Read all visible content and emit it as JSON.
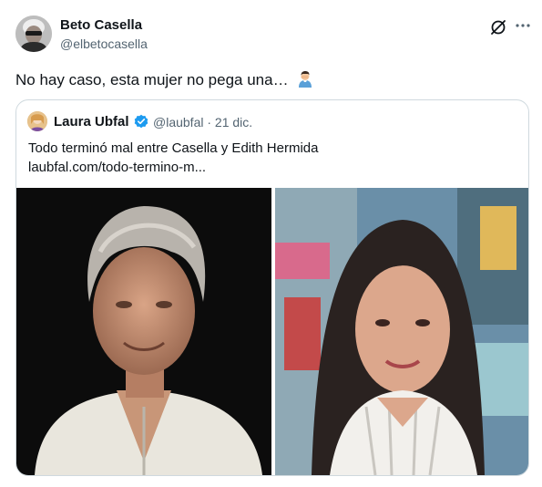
{
  "tweet": {
    "author_name": "Beto Casella",
    "author_handle": "@elbetocasella",
    "text": "No hay caso, esta mujer no pega una…",
    "emoji": "man-facepalming",
    "icons": [
      "grok-icon",
      "more-icon"
    ]
  },
  "quoted": {
    "author_name": "Laura Ubfal",
    "author_handle": "@laubfal · 21 dic.",
    "verified": true,
    "text": "Todo terminó mal entre Casella y Edith Hermida",
    "link": "laubfal.com/todo-termino-m..."
  },
  "colors": {
    "text": "#0f1419",
    "secondary": "#536471",
    "border": "#cfd9de",
    "verified": "#1d9bf0"
  }
}
